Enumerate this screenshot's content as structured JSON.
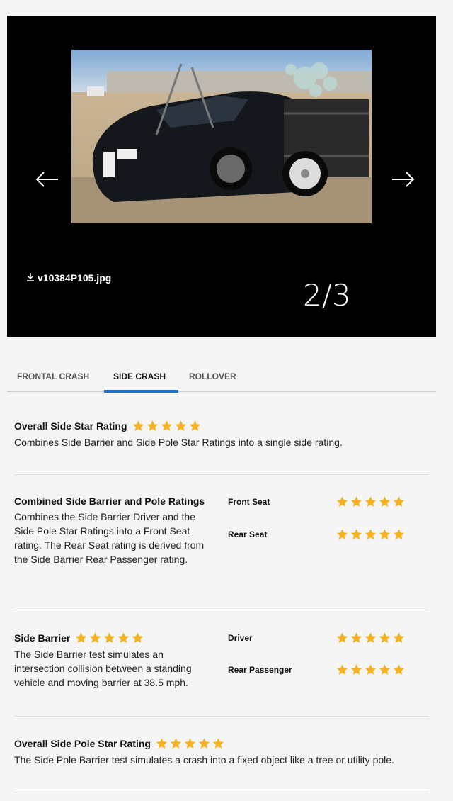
{
  "gallery": {
    "filename": "v10384P105.jpg",
    "counter": "2/3",
    "prev_icon": "arrow-left-icon",
    "next_icon": "arrow-right-icon",
    "download_icon": "download-icon"
  },
  "tabs": [
    {
      "label": "FRONTAL CRASH",
      "active": false
    },
    {
      "label": "SIDE CRASH",
      "active": true
    },
    {
      "label": "ROLLOVER",
      "active": false
    }
  ],
  "colors": {
    "accent": "#1a73c9",
    "star": "#f5b324"
  },
  "sections": {
    "overall_side": {
      "title": "Overall Side Star Rating",
      "stars": 5,
      "desc": "Combines Side Barrier and Side Pole Star Ratings into a single side rating."
    },
    "combined": {
      "title": "Combined Side Barrier and Pole Ratings",
      "desc": "Combines the Side Barrier Driver and the Side Pole Star Ratings into a Front Seat rating. The Rear Seat rating is derived from the Side Barrier Rear Passenger rating.",
      "ratings": [
        {
          "label": "Front Seat",
          "stars": 5
        },
        {
          "label": "Rear Seat",
          "stars": 5
        }
      ]
    },
    "side_barrier": {
      "title": "Side Barrier",
      "stars": 5,
      "desc": "The Side Barrier test simulates an intersection collision between a standing vehicle and moving barrier at 38.5 mph.",
      "ratings": [
        {
          "label": "Driver",
          "stars": 5
        },
        {
          "label": "Rear Passenger",
          "stars": 5
        }
      ]
    },
    "side_pole": {
      "title": "Overall Side Pole Star Rating",
      "stars": 5,
      "desc": "The Side Pole Barrier test simulates a crash into a fixed object like a tree or utility pole."
    }
  }
}
